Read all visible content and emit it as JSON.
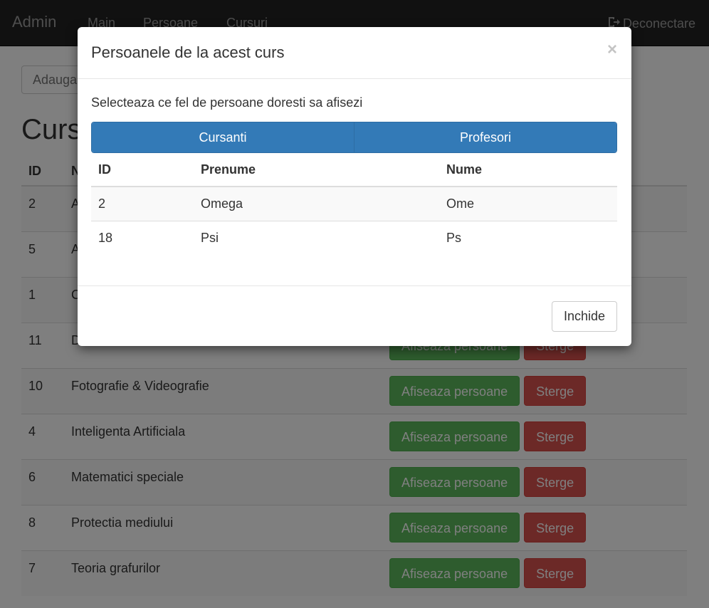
{
  "navbar": {
    "brand": "Admin",
    "links": [
      "Main",
      "Persoane",
      "Cursuri"
    ],
    "logout_label": "Deconectare",
    "logout_icon": "logout-icon"
  },
  "page": {
    "add_placeholder": "Adauga",
    "title": "Cursuri",
    "columns": [
      "ID",
      "N"
    ],
    "rows": [
      {
        "id": "2",
        "name": "A",
        "show_label": "",
        "delete_label": ""
      },
      {
        "id": "5",
        "name": "A",
        "show_label": "",
        "delete_label": ""
      },
      {
        "id": "1",
        "name": "C",
        "show_label": "",
        "delete_label": ""
      },
      {
        "id": "11",
        "name": "Dezvoltare Personala",
        "show_label": "Afiseaza persoane",
        "delete_label": "Sterge"
      },
      {
        "id": "10",
        "name": "Fotografie & Videografie",
        "show_label": "Afiseaza persoane",
        "delete_label": "Sterge"
      },
      {
        "id": "4",
        "name": "Inteligenta Artificiala",
        "show_label": "Afiseaza persoane",
        "delete_label": "Sterge"
      },
      {
        "id": "6",
        "name": "Matematici speciale",
        "show_label": "Afiseaza persoane",
        "delete_label": "Sterge"
      },
      {
        "id": "8",
        "name": "Protectia mediului",
        "show_label": "Afiseaza persoane",
        "delete_label": "Sterge"
      },
      {
        "id": "7",
        "name": "Teoria grafurilor",
        "show_label": "Afiseaza persoane",
        "delete_label": "Sterge"
      }
    ]
  },
  "modal": {
    "title": "Persoanele de la acest curs",
    "close_label": "×",
    "instruction": "Selecteaza ce fel de persoane doresti sa afisezi",
    "tabs": [
      "Cursanti",
      "Profesori"
    ],
    "columns": [
      "ID",
      "Prenume",
      "Nume"
    ],
    "rows": [
      {
        "id": "2",
        "prenume": "Omega",
        "nume": "Ome"
      },
      {
        "id": "18",
        "prenume": "Psi",
        "nume": "Ps"
      }
    ],
    "close_button": "Inchide"
  },
  "colors": {
    "primary": "#337ab7",
    "success": "#5cb85c",
    "danger": "#d9534f",
    "navbar": "#222222"
  }
}
